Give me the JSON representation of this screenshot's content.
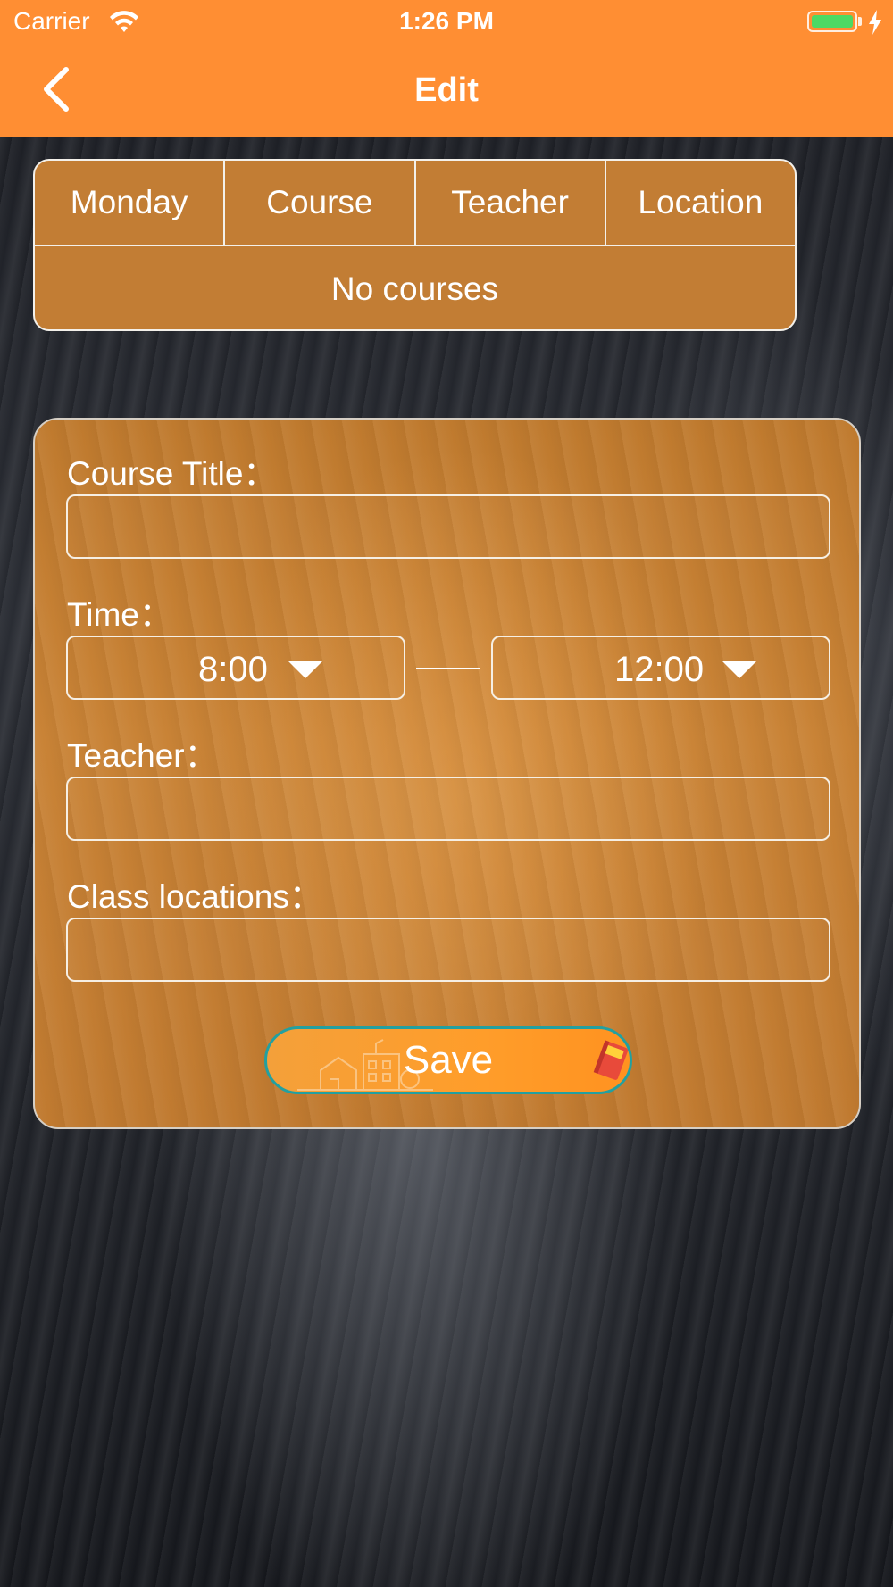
{
  "status_bar": {
    "carrier": "Carrier",
    "time": "1:26 PM",
    "battery_percent": 100
  },
  "nav": {
    "title": "Edit",
    "back_icon": "chevron-left-icon"
  },
  "schedule_table": {
    "columns": [
      "Monday",
      "Course",
      "Teacher",
      "Location"
    ],
    "empty_text": "No courses"
  },
  "form": {
    "course_title_label": "Course Title：",
    "course_title_value": "",
    "time_label": "Time：",
    "start_time": "8:00",
    "end_time": "12:00",
    "teacher_label": "Teacher：",
    "teacher_value": "",
    "location_label": "Class locations：",
    "location_value": "",
    "save_label": "Save"
  },
  "colors": {
    "nav_bar": "#ff8e33",
    "card_wood": "#c27d34",
    "save_button": "#ff9d2a",
    "save_button_border": "#23a0a0"
  }
}
